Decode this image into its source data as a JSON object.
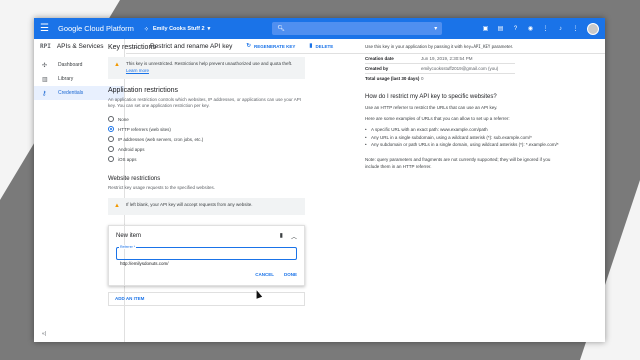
{
  "topbar": {
    "menu_icon": "hamburger-icon",
    "brand": "Google Cloud Platform",
    "project": "Emily Cooks Stuff 2",
    "search_icon": "search-icon",
    "search_chevron": "chevron-down-icon",
    "icons": [
      "gift-icon",
      "terminal-icon",
      "help-icon",
      "chat-icon",
      "more-vert-icon",
      "bell-icon",
      "kebab-icon"
    ]
  },
  "sidebar": {
    "api_badge": "RPI",
    "title": "APIs & Services",
    "items": [
      {
        "label": "Dashboard",
        "icon": "dashboard-icon",
        "glyph": "✣",
        "active": false
      },
      {
        "label": "Library",
        "icon": "library-icon",
        "glyph": "▥",
        "active": false
      },
      {
        "label": "Credentials",
        "icon": "key-icon",
        "glyph": "⚷",
        "active": true
      }
    ],
    "collapse": "«|"
  },
  "pagehead": {
    "back_glyph": "←",
    "title": "Restrict and rename API key",
    "regen_label": "REGENERATE KEY",
    "regen_glyph": "↻",
    "delete_label": "DELETE",
    "delete_glyph": "🗑"
  },
  "key_restrictions": {
    "heading": "Key restrictions",
    "warning": "This key is unrestricted. Restrictions help prevent unauthorized use and quota theft.",
    "learn_more": "Learn more"
  },
  "app_restrictions": {
    "heading": "Application restrictions",
    "desc": "An application restriction controls which websites, IP addresses, or applications can use your API key. You can set one application restriction per key.",
    "options": [
      {
        "label": "None",
        "selected": false
      },
      {
        "label": "HTTP referrers (web sites)",
        "selected": true
      },
      {
        "label": "IP addresses (web servers, cron jobs, etc.)",
        "selected": false
      },
      {
        "label": "Android apps",
        "selected": false
      },
      {
        "label": "iOS apps",
        "selected": false
      }
    ]
  },
  "website_restrictions": {
    "heading": "Website restrictions",
    "desc": "Restrict key usage requests to the specified websites.",
    "warning": "If left blank, your API key will accept requests from any website."
  },
  "new_item": {
    "title": "New item",
    "field_label": "Referrer *",
    "field_value": "http://emilysdonuts.com/",
    "hint": "",
    "cancel": "CANCEL",
    "done": "DONE",
    "add_item": "ADD AN ITEM"
  },
  "right_panel": {
    "intro_prefix": "Use this key in your application by passing it with",
    "intro_code": "key=API_KEY",
    "intro_suffix": "parameter.",
    "meta": [
      {
        "k": "Creation date",
        "v": "Jun 19, 2019, 2:30:54 PM"
      },
      {
        "k": "Created by",
        "v": "emilycooksstuff2019@gmail.com (you)"
      },
      {
        "k": "Total usage (last 30 days)",
        "v": "0"
      }
    ],
    "question": "How do I restrict my API key to specific websites?",
    "p1": "Use an HTTP referrer to restrict the URLs that can use an API key.",
    "p2": "Here are some examples of URLs that you can allow to set up a referrer:",
    "bullets": [
      "A specific URL with an exact path: www.example.com/path",
      "Any URL in a single subdomain, using a wildcard asterisk (*): sub.example.com/*",
      "Any subdomain or path URLs in a single domain, using wildcard asterisks (*): *.example.com/*"
    ],
    "note": "Note: query parameters and fragments are not currently supported; they will be ignored if you include them in an HTTP referrer."
  },
  "colors": {
    "accent": "#1a73e8",
    "warning": "#f29900"
  }
}
